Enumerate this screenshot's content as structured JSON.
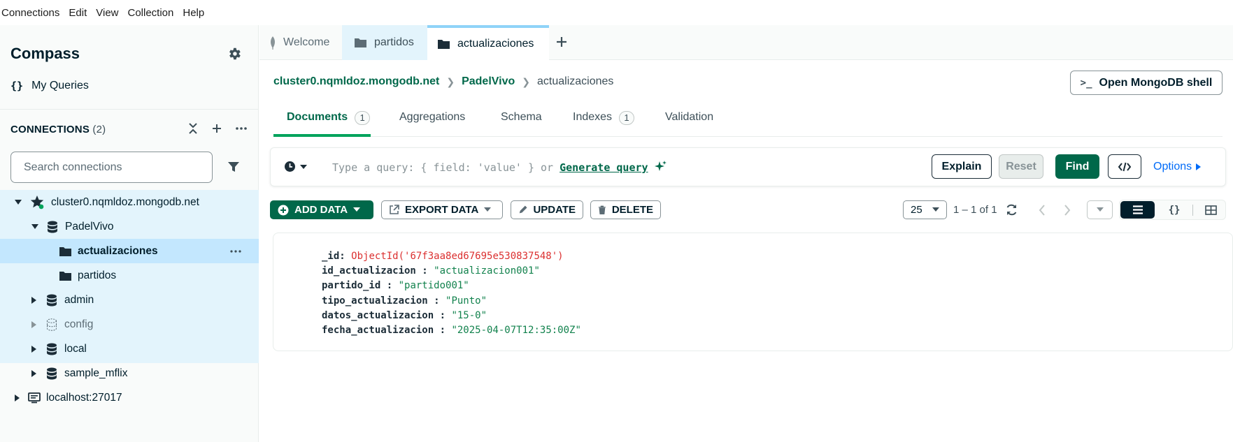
{
  "menu": [
    "Connections",
    "Edit",
    "View",
    "Collection",
    "Help"
  ],
  "sidebar": {
    "title": "Compass",
    "my_queries": "My Queries",
    "connections_label": "CONNECTIONS",
    "connections_count": "(2)",
    "search_placeholder": "Search connections",
    "tree": [
      {
        "label": "cluster0.nqmldoz.mongodb.net",
        "level": 0,
        "expanded": true,
        "icon": "star-icon"
      },
      {
        "label": "PadelVivo",
        "level": 1,
        "expanded": true,
        "icon": "database-icon"
      },
      {
        "label": "actualizaciones",
        "level": 2,
        "selected": true,
        "icon": "folder-icon"
      },
      {
        "label": "partidos",
        "level": 2,
        "icon": "folder-icon"
      },
      {
        "label": "admin",
        "level": 1,
        "expanded": false,
        "icon": "database-icon"
      },
      {
        "label": "config",
        "level": 1,
        "expanded": false,
        "icon": "database-dashed-icon"
      },
      {
        "label": "local",
        "level": 1,
        "expanded": false,
        "icon": "database-icon"
      },
      {
        "label": "sample_mflix",
        "level": 1,
        "expanded": false,
        "icon": "database-icon"
      },
      {
        "label": "localhost:27017",
        "level": 0,
        "expanded": false,
        "icon": "computer-icon"
      }
    ]
  },
  "tabs": [
    {
      "label": "Welcome",
      "icon": "leaf-icon"
    },
    {
      "label": "partidos",
      "icon": "folder-icon"
    },
    {
      "label": "actualizaciones",
      "icon": "folder-icon",
      "active": true
    }
  ],
  "breadcrumb": {
    "cluster": "cluster0.nqmldoz.mongodb.net",
    "database": "PadelVivo",
    "collection": "actualizaciones"
  },
  "shell_button": "Open MongoDB shell",
  "subtabs": [
    {
      "label": "Documents",
      "badge": "1",
      "active": true
    },
    {
      "label": "Aggregations"
    },
    {
      "label": "Schema"
    },
    {
      "label": "Indexes",
      "badge": "1"
    },
    {
      "label": "Validation"
    }
  ],
  "query": {
    "placeholder_prefix": "Type a query: { field: 'value' } or",
    "generate": "Generate query",
    "explain": "Explain",
    "reset": "Reset",
    "find": "Find",
    "options": "Options"
  },
  "toolbar": {
    "add_data": "ADD DATA",
    "export_data": "EXPORT DATA",
    "update": "UPDATE",
    "delete": "DELETE",
    "page_size": "25",
    "range": "1 – 1 of 1"
  },
  "document": [
    {
      "key": "_id",
      "value": "ObjectId('67f3aa8ed67695e530837548')",
      "type": "objectid"
    },
    {
      "key": "id_actualizacion",
      "value": "\"actualizacion001\"",
      "type": "string"
    },
    {
      "key": "partido_id",
      "value": "\"partido001\"",
      "type": "string"
    },
    {
      "key": "tipo_actualizacion",
      "value": "\"Punto\"",
      "type": "string"
    },
    {
      "key": "datos_actualizacion",
      "value": "\"15-0\"",
      "type": "string"
    },
    {
      "key": "fecha_actualizacion",
      "value": "\"2025-04-07T12:35:00Z\"",
      "type": "string"
    }
  ],
  "colors": {
    "accent_green": "#00684a",
    "find_button": "#00684a",
    "objectid_red": "#db3030",
    "string_green": "#12824d",
    "sidebar_selection": "#c3e7fe",
    "tree_background": "#e3f4fc"
  }
}
